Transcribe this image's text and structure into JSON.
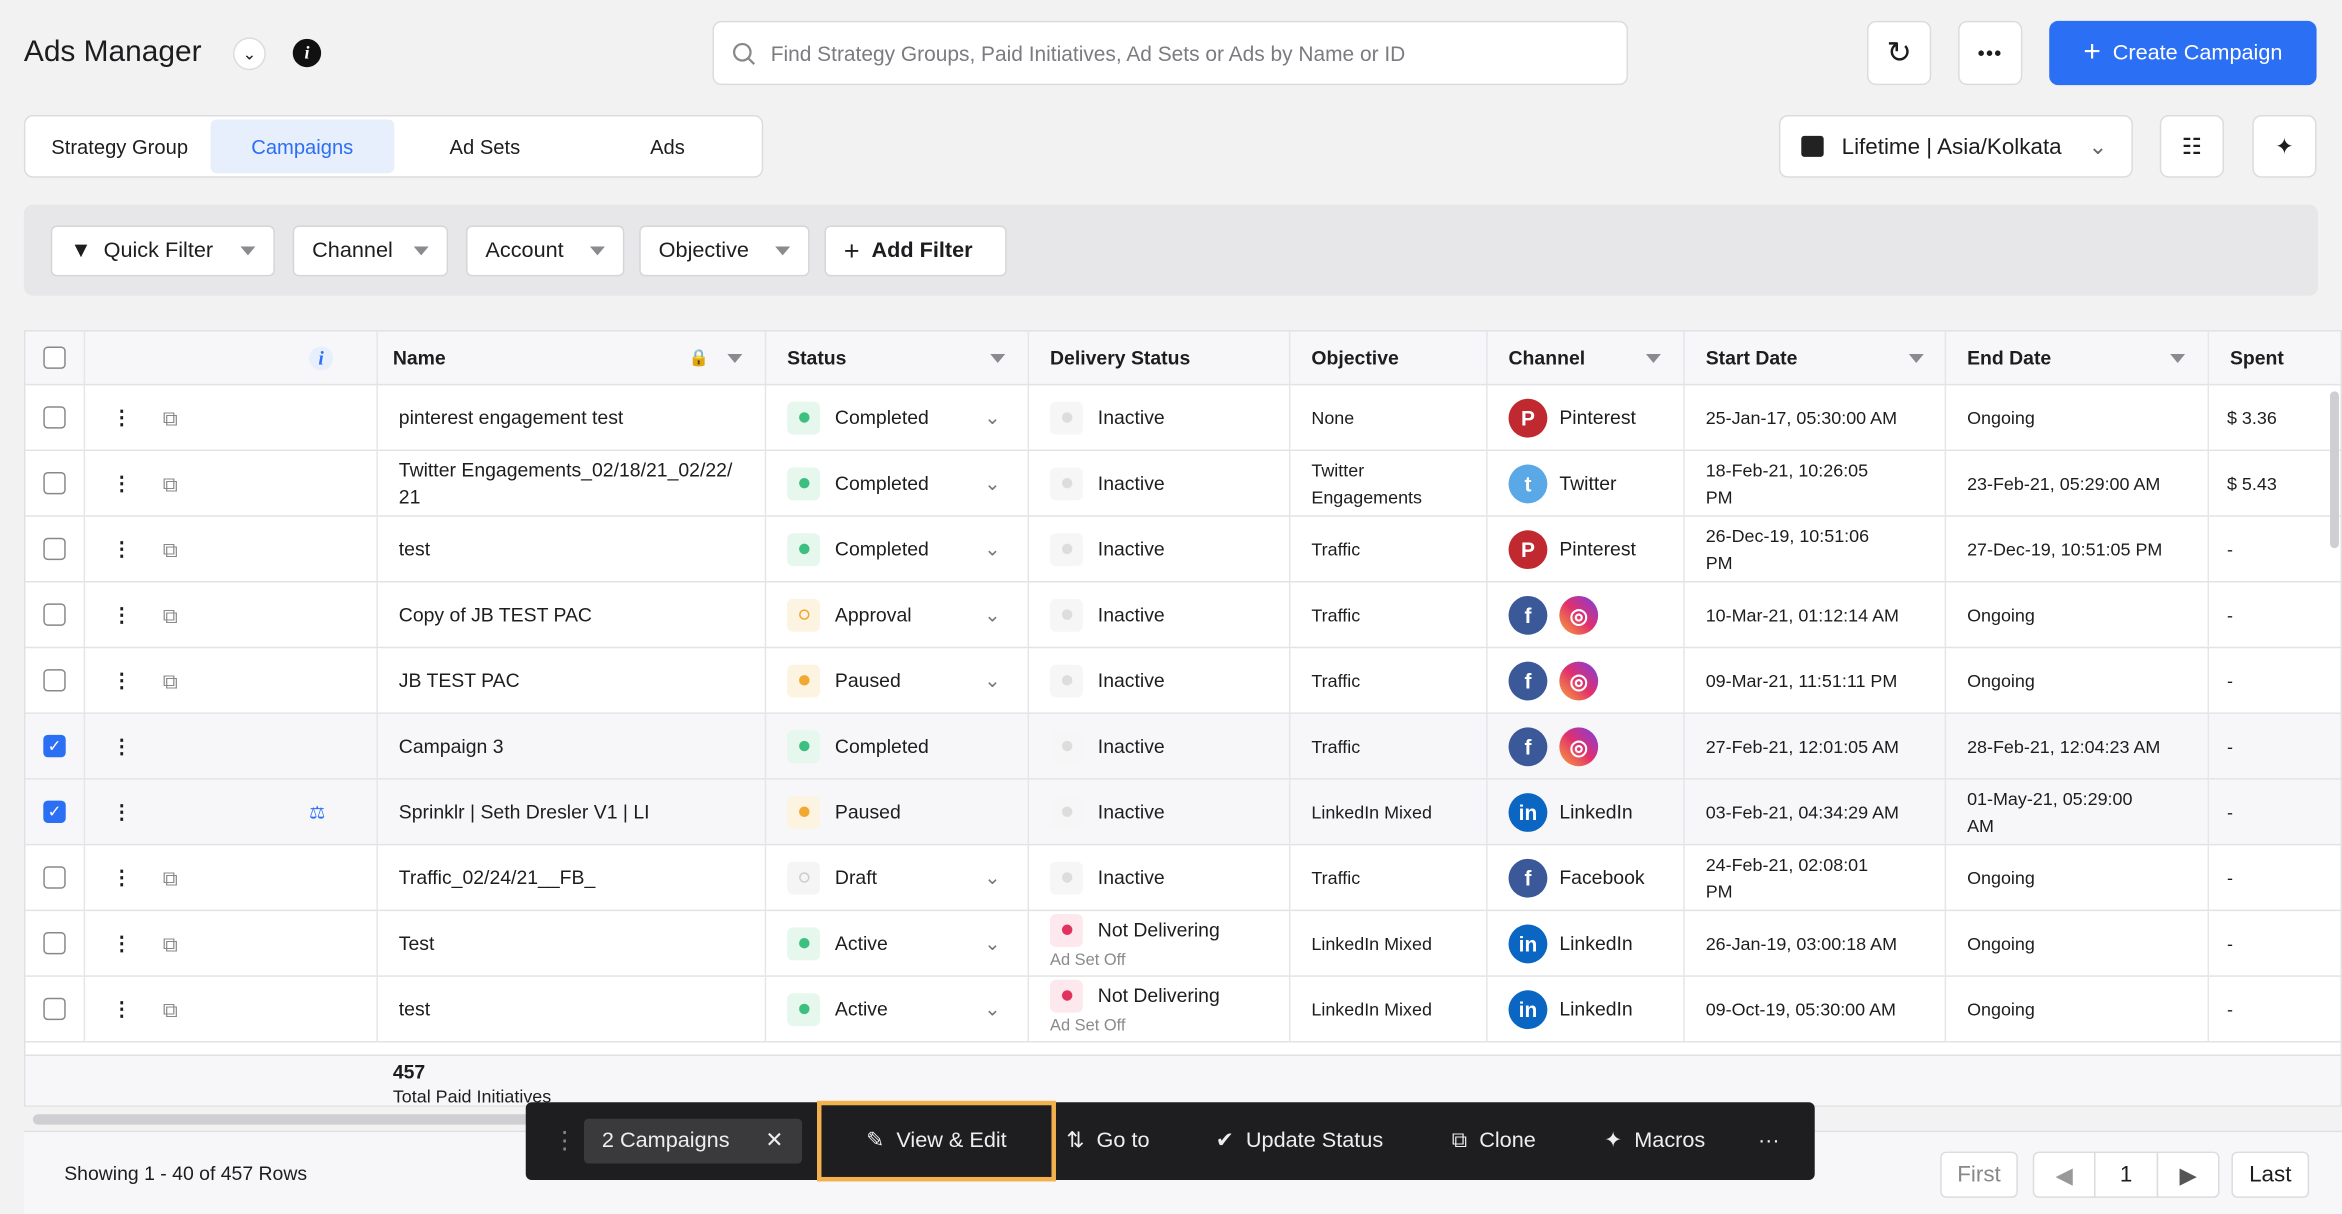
{
  "header": {
    "title": "Ads Manager",
    "search_placeholder": "Find Strategy Groups, Paid Initiatives, Ad Sets or Ads by Name or ID",
    "create_label": "Create Campaign",
    "date_range": "Lifetime | Asia/Kolkata"
  },
  "tabs": [
    {
      "label": "Strategy Group"
    },
    {
      "label": "Campaigns",
      "active": true
    },
    {
      "label": "Ad Sets"
    },
    {
      "label": "Ads"
    }
  ],
  "filters": {
    "quick": "Quick Filter",
    "channel": "Channel",
    "account": "Account",
    "objective": "Objective",
    "add": "Add Filter"
  },
  "columns": {
    "name": "Name",
    "status": "Status",
    "delivery": "Delivery Status",
    "objective": "Objective",
    "channel": "Channel",
    "start": "Start Date",
    "end": "End Date",
    "spent": "Spent"
  },
  "colors": {
    "accent": "#2b6ff4",
    "completed": "#3dbf7f",
    "approval": "#f0a830",
    "paused": "#f0a830",
    "draft": "#cfcfd3",
    "not_delivering": "#e0335e",
    "pinterest": "#c0292f",
    "twitter": "#5aa9e6",
    "facebook": "#3b5998",
    "linkedin": "#0a66c2"
  },
  "rows": [
    {
      "checked": false,
      "name": "pinterest engagement test",
      "status": "Completed",
      "st": "completed",
      "delivery": "Inactive",
      "delivery_sub": "",
      "objective": "None",
      "channels": [
        "pinterest"
      ],
      "channel_label": "Pinterest",
      "start": "25-Jan-17, 05:30:00 AM",
      "end": "Ongoing",
      "spent": "$ 3.36"
    },
    {
      "checked": false,
      "name": "Twitter Engagements_02/18/21_02/22/21",
      "status": "Completed",
      "st": "completed",
      "delivery": "Inactive",
      "delivery_sub": "",
      "objective": "Twitter Engagements",
      "channels": [
        "twitter"
      ],
      "channel_label": "Twitter",
      "start": "18-Feb-21, 10:26:05 PM",
      "end": "23-Feb-21, 05:29:00 AM",
      "spent": "$ 5.43"
    },
    {
      "checked": false,
      "name": "test",
      "status": "Completed",
      "st": "completed",
      "delivery": "Inactive",
      "delivery_sub": "",
      "objective": "Traffic",
      "channels": [
        "pinterest"
      ],
      "channel_label": "Pinterest",
      "start": "26-Dec-19, 10:51:06 PM",
      "end": "27-Dec-19, 10:51:05 PM",
      "spent": "-"
    },
    {
      "checked": false,
      "name": "Copy of JB TEST PAC",
      "status": "Approval",
      "st": "approval",
      "delivery": "Inactive",
      "delivery_sub": "",
      "objective": "Traffic",
      "channels": [
        "facebook",
        "instagram"
      ],
      "channel_label": "",
      "start": "10-Mar-21, 01:12:14 AM",
      "end": "Ongoing",
      "spent": "-"
    },
    {
      "checked": false,
      "name": "JB TEST PAC",
      "status": "Paused",
      "st": "paused",
      "delivery": "Inactive",
      "delivery_sub": "",
      "objective": "Traffic",
      "channels": [
        "facebook",
        "instagram"
      ],
      "channel_label": "",
      "start": "09-Mar-21, 11:51:11 PM",
      "end": "Ongoing",
      "spent": "-"
    },
    {
      "checked": true,
      "name": "Campaign 3",
      "status": "Completed",
      "st": "completed",
      "delivery": "Inactive",
      "delivery_sub": "",
      "objective": "Traffic",
      "channels": [
        "facebook",
        "instagram"
      ],
      "channel_label": "",
      "start": "27-Feb-21, 12:01:05 AM",
      "end": "28-Feb-21, 12:04:23 AM",
      "spent": "-"
    },
    {
      "checked": true,
      "name": "Sprinklr | Seth Dresler V1 | LI",
      "status": "Paused",
      "st": "paused",
      "delivery": "Inactive",
      "delivery_sub": "",
      "objective": "LinkedIn Mixed",
      "channels": [
        "linkedin"
      ],
      "channel_label": "LinkedIn",
      "start": "03-Feb-21, 04:34:29 AM",
      "end": "01-May-21, 05:29:00 AM",
      "spent": "-"
    },
    {
      "checked": false,
      "name": "Traffic_02/24/21__FB_",
      "status": "Draft",
      "st": "draft",
      "delivery": "Inactive",
      "delivery_sub": "",
      "objective": "Traffic",
      "channels": [
        "facebook"
      ],
      "channel_label": "Facebook",
      "start": "24-Feb-21, 02:08:01 PM",
      "end": "Ongoing",
      "spent": "-"
    },
    {
      "checked": false,
      "name": "Test",
      "status": "Active",
      "st": "completed",
      "delivery": "Not Delivering",
      "delivery_sub": "Ad Set Off",
      "objective": "LinkedIn Mixed",
      "channels": [
        "linkedin"
      ],
      "channel_label": "LinkedIn",
      "start": "26-Jan-19, 03:00:18 AM",
      "end": "Ongoing",
      "spent": "-"
    },
    {
      "checked": false,
      "name": "test",
      "status": "Active",
      "st": "completed",
      "delivery": "Not Delivering",
      "delivery_sub": "Ad Set Off",
      "objective": "LinkedIn Mixed",
      "channels": [
        "linkedin"
      ],
      "channel_label": "LinkedIn",
      "start": "09-Oct-19, 05:30:00 AM",
      "end": "Ongoing",
      "spent": "-"
    }
  ],
  "summary": {
    "total": "457",
    "label": "Total Paid Initiatives"
  },
  "footer": {
    "showing": "Showing 1 - 40 of 457 Rows",
    "first": "First",
    "page": "1",
    "last": "Last"
  },
  "action_bar": {
    "selection": "2 Campaigns",
    "view_edit": "View & Edit",
    "goto": "Go to",
    "update": "Update Status",
    "clone": "Clone",
    "macros": "Macros",
    "more": "···"
  }
}
